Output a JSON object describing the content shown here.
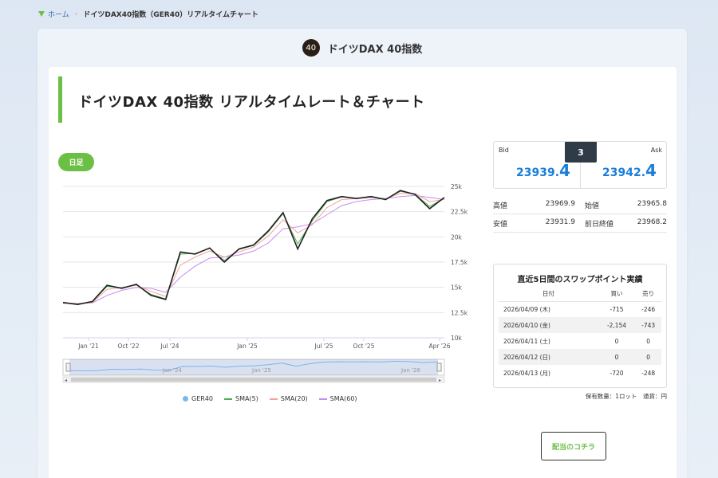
{
  "breadcrumb": {
    "home": "ホーム",
    "current": "ドイツDAX40指数（GER40）リアルタイムチャート"
  },
  "header": {
    "badge": "40",
    "title": "ドイツDAX 40指数"
  },
  "page_title": "ドイツDAX 40指数 リアルタイムレート＆チャート",
  "period_button": "日足",
  "quote": {
    "bid_label": "Bid",
    "bid_main": "23939.",
    "bid_last": "4",
    "ask_label": "Ask",
    "ask_main": "23942.",
    "ask_last": "4",
    "spread": "3"
  },
  "stats": [
    {
      "label": "高値",
      "value": "23969.9",
      "label2": "始値",
      "value2": "23965.8"
    },
    {
      "label": "安値",
      "value": "23931.9",
      "label2": "前日終値",
      "value2": "23968.2"
    }
  ],
  "swap": {
    "title": "直近5日間のスワップポイント実績",
    "headers": [
      "日付",
      "買い",
      "売り"
    ],
    "rows": [
      [
        "2026/04/09 (木)",
        "-715",
        "-246"
      ],
      [
        "2026/04/10 (金)",
        "-2,154",
        "-743"
      ],
      [
        "2026/04/11 (土)",
        "0",
        "0"
      ],
      [
        "2026/04/12 (日)",
        "0",
        "0"
      ],
      [
        "2026/04/13 (月)",
        "-720",
        "-248"
      ]
    ],
    "note": "保有数量：1ロット　通貨：円"
  },
  "dividend_button": "配当のコチラ",
  "colors": {
    "accent": "#6cbf45",
    "price": "#1a7ed8",
    "sma5": "#4caf50",
    "sma20": "#f4a0a0",
    "sma60": "#c58cf0"
  },
  "chart_data": {
    "type": "line",
    "x_ticks": [
      "Jan '21",
      "Oct '22",
      "Jul '24",
      "Jan '25",
      "Jul '25",
      "Oct '25",
      "Apr '26"
    ],
    "y_ticks": [
      "25k",
      "22.5k",
      "20k",
      "17.5k",
      "15k",
      "12.5k",
      "10k"
    ],
    "ylim": [
      10000,
      25000
    ],
    "navigator_ticks": [
      "Jan '24",
      "Jan '25",
      "Jan '26"
    ],
    "series": [
      {
        "name": "GER40",
        "values": [
          13500,
          13300,
          13600,
          15200,
          14900,
          15300,
          14200,
          13800,
          18500,
          18300,
          18900,
          17500,
          18800,
          19200,
          20600,
          22400,
          18800,
          21800,
          23600,
          24000,
          23800,
          24000,
          23700,
          24600,
          24200,
          22800,
          23900
        ]
      },
      {
        "name": "SMA(5)",
        "values": [
          13500,
          13350,
          13550,
          15100,
          14950,
          15250,
          14300,
          13850,
          18300,
          18350,
          18850,
          17650,
          18750,
          19150,
          20500,
          22300,
          19300,
          21600,
          23500,
          23950,
          23850,
          23950,
          23750,
          24500,
          24250,
          23000,
          23850
        ]
      },
      {
        "name": "SMA(20)",
        "values": [
          13450,
          13400,
          13500,
          14800,
          15000,
          15200,
          14600,
          14100,
          17200,
          18000,
          18600,
          18000,
          18500,
          19000,
          20100,
          21700,
          20400,
          21200,
          22900,
          23700,
          23800,
          23900,
          23800,
          24300,
          24300,
          23500,
          23700
        ]
      },
      {
        "name": "SMA(60)",
        "values": [
          13400,
          13400,
          13450,
          14200,
          14700,
          15000,
          14900,
          14500,
          16000,
          17100,
          17900,
          18000,
          18200,
          18600,
          19400,
          20800,
          21000,
          21300,
          22200,
          23100,
          23500,
          23700,
          23800,
          24000,
          24100,
          23900,
          23700
        ]
      }
    ]
  }
}
